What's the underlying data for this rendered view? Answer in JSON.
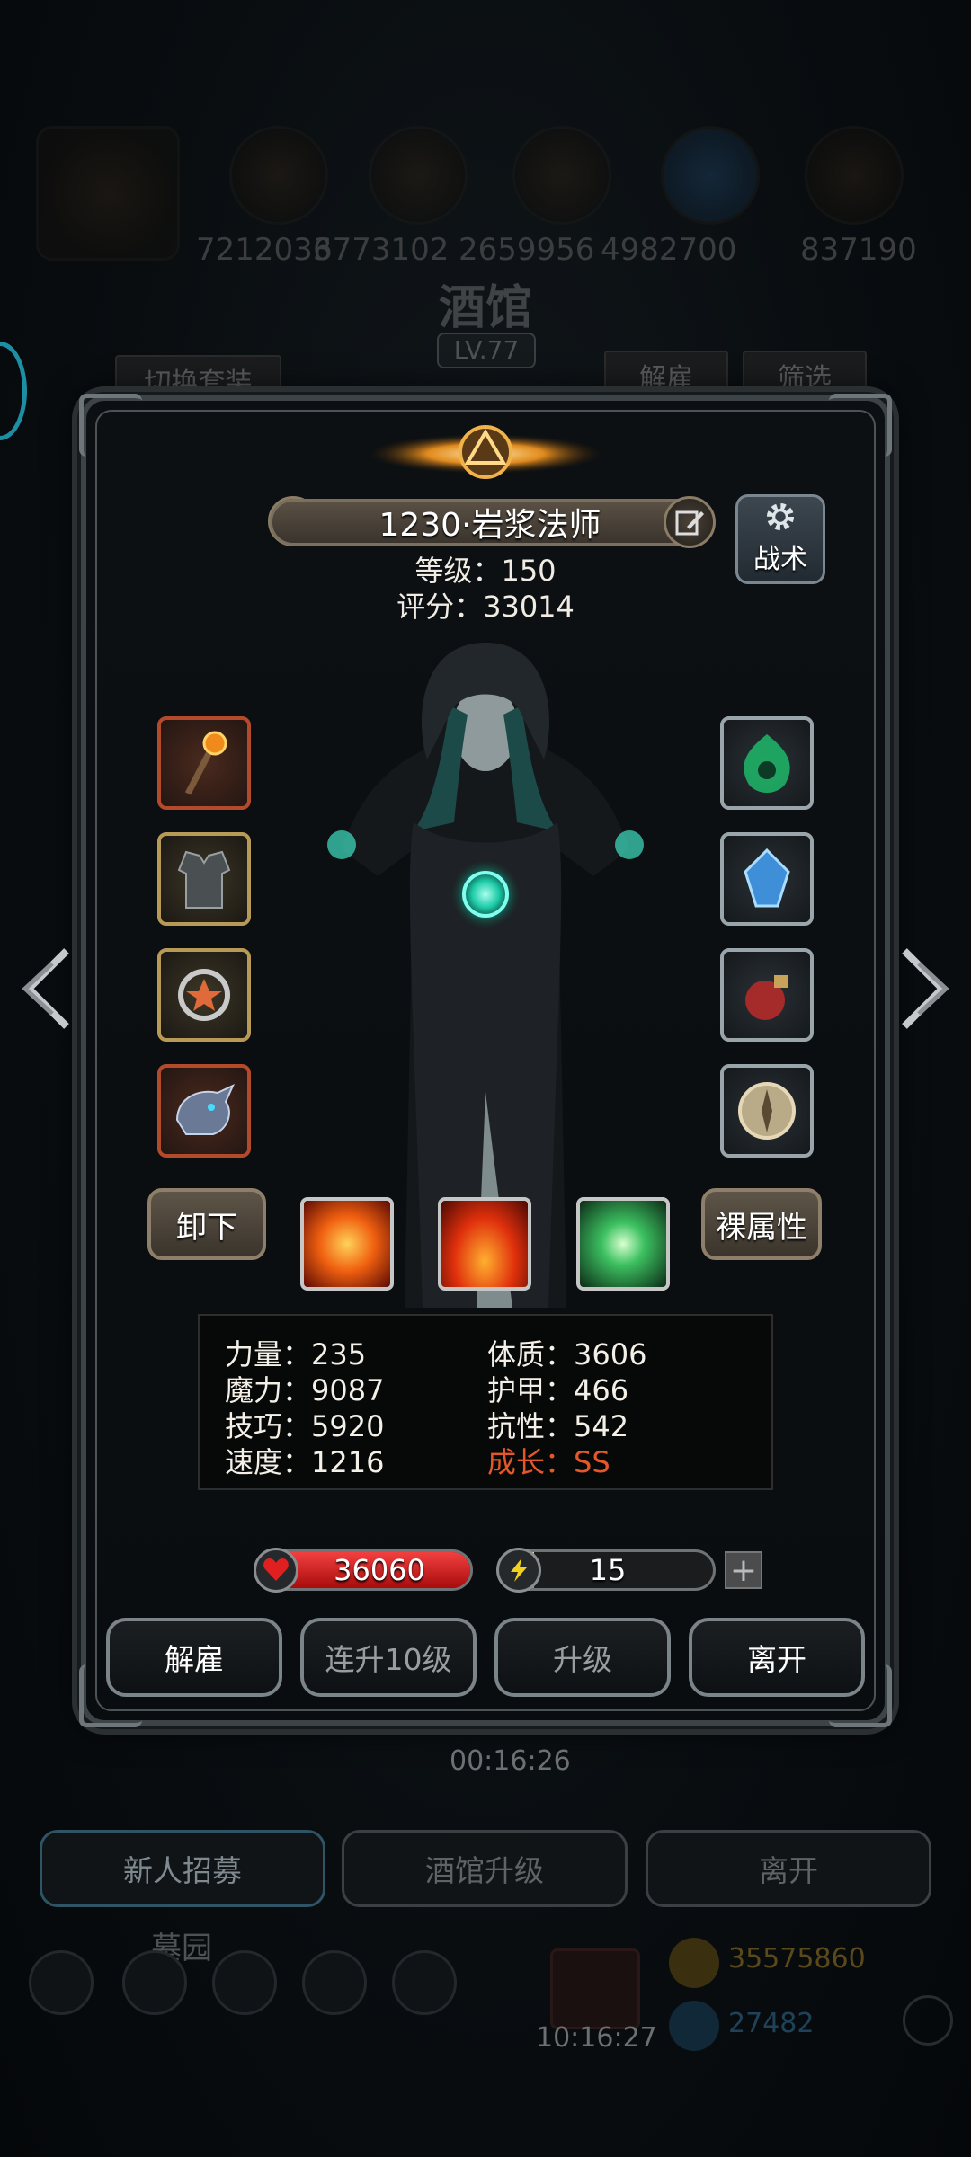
{
  "background": {
    "resources": [
      "7212033",
      "6773102",
      "2659956",
      "4982700",
      "837190"
    ],
    "title": "酒馆",
    "level": "LV.77",
    "switch_outfit": "切换套装",
    "dismiss": "解雇",
    "filter": "筛选",
    "timer": "00:16:26",
    "tabs": [
      "新人招募",
      "酒馆升级",
      "离开"
    ],
    "garden": "墓园",
    "clock": "10:16:27",
    "currency1": "35575860",
    "currency2": "27482"
  },
  "hero": {
    "name": "1230·岩浆法师",
    "level_line": "等级：150",
    "score_line": "评分：33014",
    "tactics_label": "战术"
  },
  "equipment": {
    "left": [
      "staff-icon",
      "robe-icon",
      "ring-icon",
      "dragon-helm-icon"
    ],
    "right": [
      "green-flame-amulet-icon",
      "blue-crystal-icon",
      "red-potion-icon",
      "compass-icon"
    ]
  },
  "controls": {
    "unequip": "卸下",
    "base_attributes": "裸属性"
  },
  "skills": [
    "fire-burst-icon",
    "flame-icon",
    "green-light-icon"
  ],
  "stats": [
    {
      "label": "力量：235"
    },
    {
      "label": "体质：3606"
    },
    {
      "label": "魔力：9087"
    },
    {
      "label": "护甲：466"
    },
    {
      "label": "技巧：5920"
    },
    {
      "label": "抗性：542"
    },
    {
      "label": "速度：1216"
    },
    {
      "label": "成长：SS",
      "color": "#e5572a"
    }
  ],
  "bars": {
    "hp_value": "36060",
    "hp_fill": 1.0,
    "energy_value": "15",
    "energy_fill": 0.15,
    "hp_color": "#d0191a",
    "energy_color": "#d8c21d"
  },
  "actions": [
    "解雇",
    "连升10级",
    "升级",
    "离开"
  ]
}
